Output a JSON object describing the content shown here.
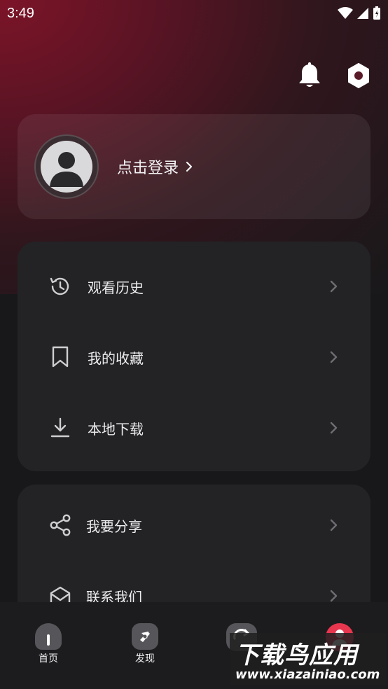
{
  "status_bar": {
    "time": "3:49"
  },
  "login": {
    "label": "点击登录"
  },
  "menu_group_1": [
    {
      "label": "观看历史",
      "icon": "history-icon"
    },
    {
      "label": "我的收藏",
      "icon": "bookmark-icon"
    },
    {
      "label": "本地下载",
      "icon": "download-icon"
    }
  ],
  "menu_group_2": [
    {
      "label": "我要分享",
      "icon": "share-icon"
    },
    {
      "label": "联系我们",
      "icon": "contact-icon"
    }
  ],
  "bottom_nav": [
    {
      "label": "首页",
      "icon": "home-icon"
    },
    {
      "label": "发现",
      "icon": "compass-icon"
    },
    {
      "label": "",
      "icon": "refresh-icon"
    },
    {
      "label": "",
      "icon": "profile-icon"
    }
  ],
  "watermark": {
    "title": "下载鸟应用",
    "url": "www.xiazainiao.com"
  },
  "colors": {
    "accent": "#e8364f",
    "gradient_top": "#7d1428",
    "background": "#18181a",
    "card": "#232326"
  }
}
